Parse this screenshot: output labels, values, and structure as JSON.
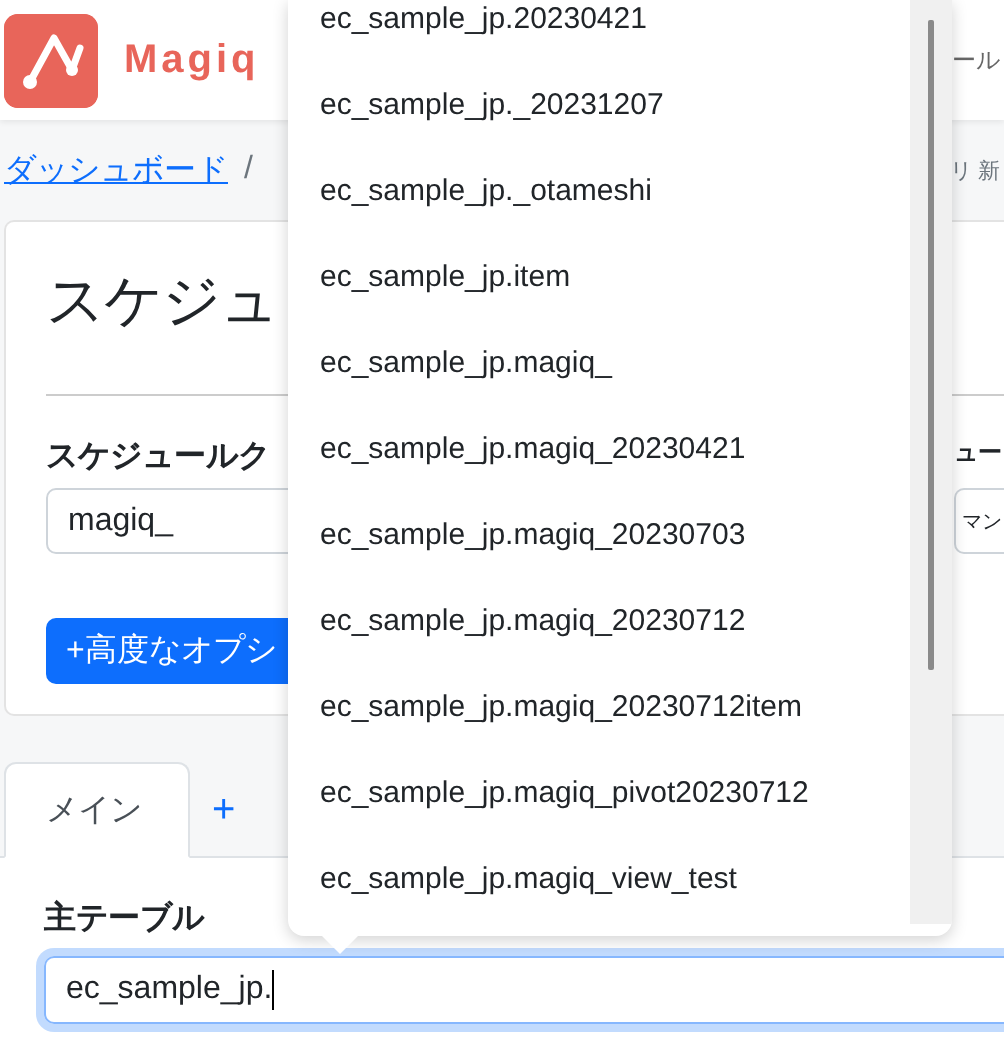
{
  "header": {
    "brand": "Magiq",
    "nav_text": "ール"
  },
  "breadcrumb": [
    {
      "label": "ダッシュボード",
      "kind": "link"
    },
    {
      "label": "/",
      "kind": "separator"
    },
    {
      "label": "リ 新",
      "kind": "text"
    }
  ],
  "card": {
    "title": "スケジュ",
    "fields": [
      {
        "label": "スケジュールク",
        "value": "magiq_"
      },
      {
        "label": "ュー",
        "value": "マン"
      }
    ],
    "advanced_button": "+高度なオプシ"
  },
  "tabs": [
    {
      "label": "メイン",
      "selected": true
    },
    {
      "label": "+",
      "selected": false
    }
  ],
  "main_table": {
    "label": "主テーブル",
    "value": "ec_sample_jp.",
    "focused": true
  },
  "suggestions": [
    "ec_sample_jp.20230421",
    "ec_sample_jp._20231207",
    "ec_sample_jp._otameshi",
    "ec_sample_jp.item",
    "ec_sample_jp.magiq_",
    "ec_sample_jp.magiq_20230421",
    "ec_sample_jp.magiq_20230703",
    "ec_sample_jp.magiq_20230712",
    "ec_sample_jp.magiq_20230712item",
    "ec_sample_jp.magiq_pivot20230712",
    "ec_sample_jp.magiq_view_test"
  ]
}
